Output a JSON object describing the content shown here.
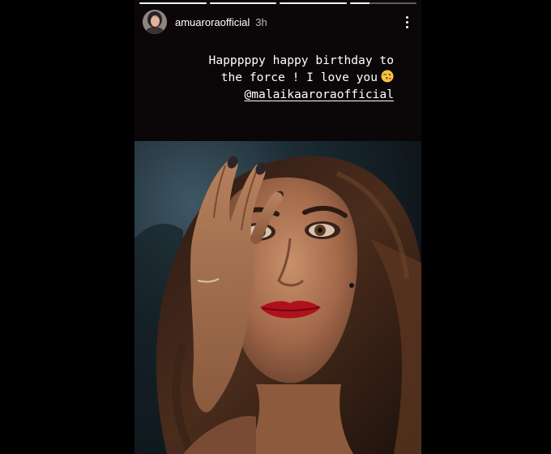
{
  "story": {
    "username": "amuaroraofficial",
    "time": "3h",
    "progress": [
      1,
      1,
      1,
      0.3
    ],
    "caption_lines": [
      "Happpppy happy birthday to",
      "the force ! I love you"
    ],
    "caption_emoji": "kissing-face-emoji",
    "mention": "@malaikaaroraofficial",
    "more_icon": "vertical-ellipsis-icon"
  },
  "colors": {
    "page_background": "#000000",
    "story_background": "#0b0709",
    "text": "#ffffff",
    "lips": "#b0111c"
  }
}
